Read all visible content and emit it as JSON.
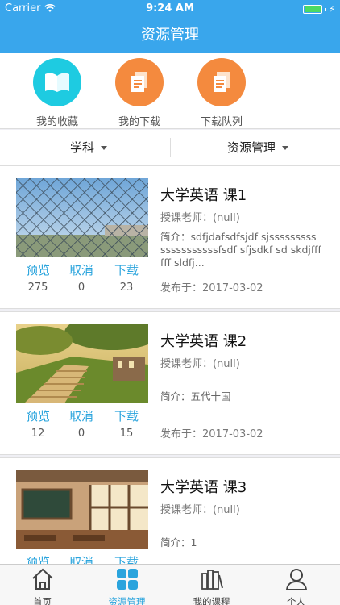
{
  "status": {
    "carrier": "Carrier",
    "time": "9:24 AM"
  },
  "nav": {
    "title": "资源管理"
  },
  "quick": [
    {
      "label": "我的收藏",
      "icon": "book-icon",
      "color": "#1ecbe1"
    },
    {
      "label": "我的下载",
      "icon": "document-icon",
      "color": "#f48a3e"
    },
    {
      "label": "下载队列",
      "icon": "document-icon",
      "color": "#f48a3e"
    }
  ],
  "filter": {
    "subject": "学科",
    "manage": "资源管理"
  },
  "actions": {
    "preview": "预览",
    "cancel": "取消",
    "download": "下载"
  },
  "cards": [
    {
      "title": "大学英语 课1",
      "teacher": "授课老师：(null)",
      "desc": "简介：sdfjdafsdfsjdf sjssssssssssssssssssssfsdf sfjsdkf sd skdjffffff sldfj...",
      "date": "发布于：2017-03-02",
      "preview_count": "275",
      "cancel_count": "0",
      "download_count": "23",
      "thumb": "fence-photo"
    },
    {
      "title": "大学英语 课2",
      "teacher": "授课老师：(null)",
      "desc": "简介：五代十国",
      "date": "发布于：2017-03-02",
      "preview_count": "12",
      "cancel_count": "0",
      "download_count": "15",
      "thumb": "stairs-photo"
    },
    {
      "title": "大学英语 课3",
      "teacher": "授课老师：(null)",
      "desc": "简介：1",
      "date": "",
      "preview_count": "",
      "cancel_count": "",
      "download_count": "",
      "thumb": "classroom-photo"
    }
  ],
  "tabs": [
    {
      "label": "首页",
      "icon": "home-icon"
    },
    {
      "label": "资源管理",
      "icon": "grid-icon"
    },
    {
      "label": "我的课程",
      "icon": "books-icon"
    },
    {
      "label": "个人",
      "icon": "person-icon"
    }
  ],
  "colors": {
    "brand": "#39a6ec",
    "accent": "#2aa4dd"
  }
}
